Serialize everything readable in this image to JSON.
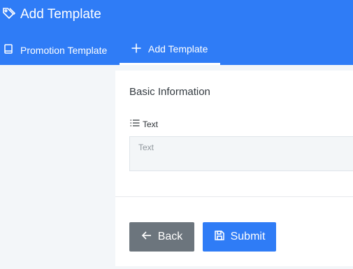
{
  "header": {
    "title": "Add Template",
    "title_icon": "tags-icon",
    "background": "#2f7cf6"
  },
  "tabs": [
    {
      "label": "Promotion Template",
      "icon": "book-icon",
      "active": false
    },
    {
      "label": "Add Template",
      "icon": "plus-icon",
      "active": true
    }
  ],
  "form": {
    "section_title": "Basic Information",
    "text_field": {
      "label": "Text",
      "icon": "list-icon",
      "placeholder": "Text",
      "value": ""
    }
  },
  "actions": {
    "back_label": "Back",
    "back_icon": "arrow-left-icon",
    "submit_label": "Submit",
    "submit_icon": "save-icon",
    "back_color": "#6c757d",
    "submit_color": "#2f7cf6"
  }
}
